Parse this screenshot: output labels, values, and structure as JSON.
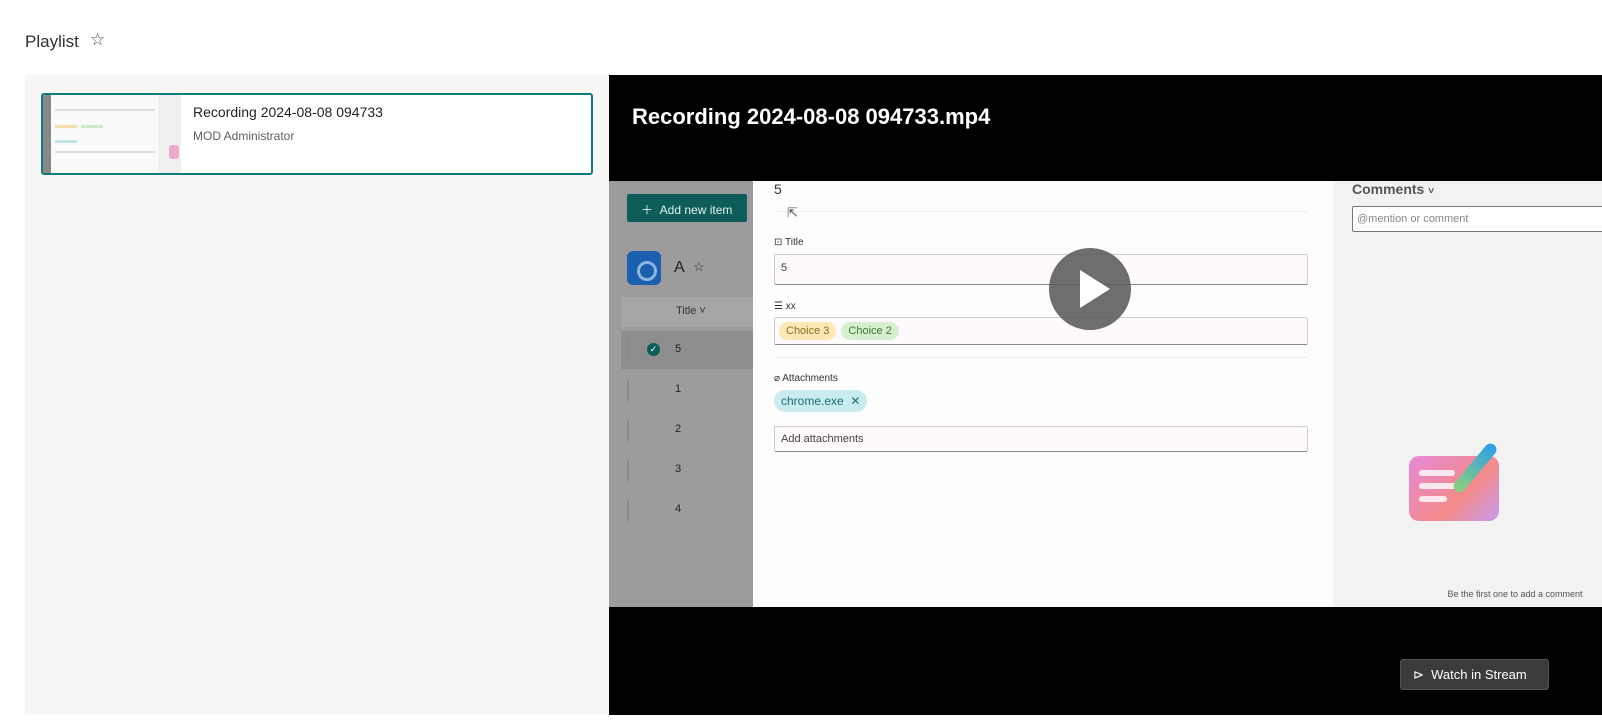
{
  "page": {
    "title": "Playlist",
    "favorite_icon": "star-outline-icon"
  },
  "playlist": {
    "items": [
      {
        "title": "Recording 2024-08-08 094733",
        "author": "MOD Administrator",
        "selected": true
      }
    ]
  },
  "player": {
    "title": "Recording 2024-08-08 094733.mp4",
    "play_icon": "play-icon",
    "watch_label": "Watch in Stream",
    "frame": {
      "add_new_item": "Add new item",
      "site_name": "A",
      "column_header": "Title",
      "rows": [
        "5",
        "1",
        "2",
        "3",
        "4"
      ],
      "item_heading": "5",
      "title_label": "Title",
      "title_value": "5",
      "xx_label": "xx",
      "choices": [
        {
          "label": "Choice 3",
          "color": "#fde7b5"
        },
        {
          "label": "Choice 2",
          "color": "#d6f0cf"
        }
      ],
      "attachments_label": "Attachments",
      "attachment_file": "chrome.exe",
      "add_attachments": "Add attachments",
      "comments_title": "Comments",
      "comment_placeholder": "@mention or comment",
      "comments_empty": "Be the first one to add a comment"
    }
  },
  "colors": {
    "accent": "#0f7b83"
  }
}
